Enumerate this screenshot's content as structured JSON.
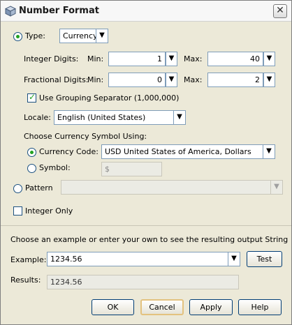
{
  "window": {
    "title": "Number Format"
  },
  "type_option": {
    "label": "Type:",
    "selected": true,
    "value": "Currency"
  },
  "integer_digits": {
    "label": "Integer Digits:",
    "min_label": "Min:",
    "min": "1",
    "max_label": "Max:",
    "max": "40"
  },
  "fractional_digits": {
    "label": "Fractional Digits:",
    "min_label": "Min:",
    "min": "0",
    "max_label": "Max:",
    "max": "2"
  },
  "grouping": {
    "label": "Use Grouping Separator (1,000,000)",
    "checked": true
  },
  "locale": {
    "label": "Locale:",
    "value": "English (United States)"
  },
  "currency": {
    "heading": "Choose Currency Symbol Using:",
    "code_label": "Currency Code:",
    "code_value": "USD United States of America, Dollars",
    "symbol_label": "Symbol:",
    "symbol_value": "$"
  },
  "pattern": {
    "label": "Pattern",
    "value": ""
  },
  "integer_only": {
    "label": "Integer Only",
    "checked": false
  },
  "example_section": {
    "instructions": "Choose an example or enter your own to see the resulting output String",
    "example_label": "Example:",
    "example_value": "1234.56",
    "test_label": "Test",
    "results_label": "Results:",
    "results_value": "1234.56"
  },
  "buttons": {
    "ok": "OK",
    "cancel": "Cancel",
    "apply": "Apply",
    "help": "Help"
  },
  "icons": {
    "down_arrow": "▼",
    "close": "✕"
  }
}
